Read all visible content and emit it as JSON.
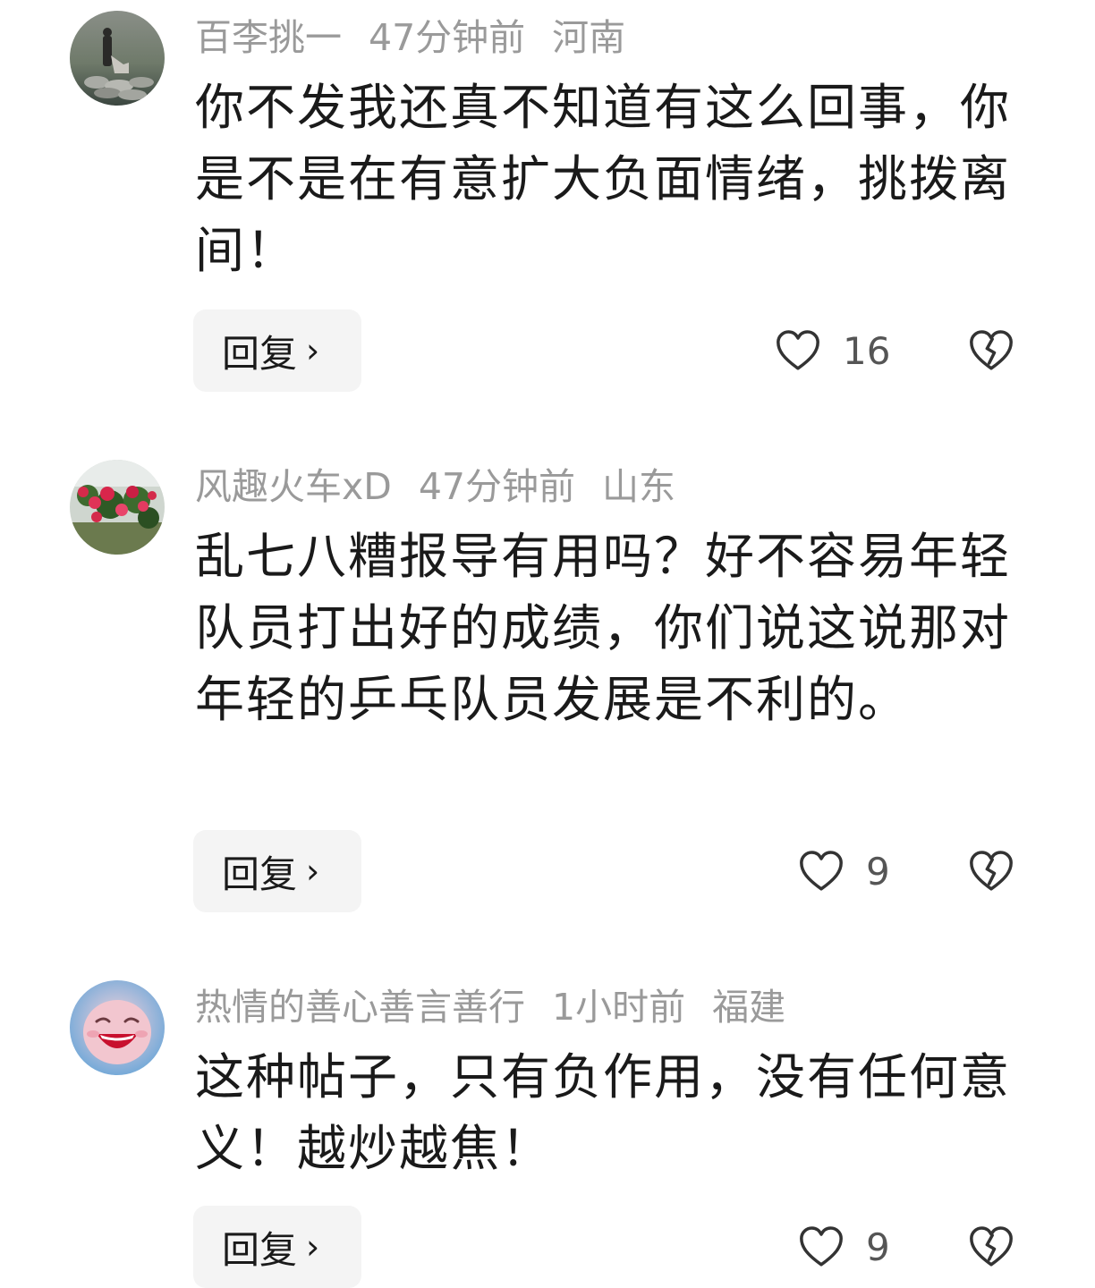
{
  "comments": [
    {
      "username": "百李挑一",
      "time": "47分钟前",
      "location": "河南",
      "text": "你不发我还真不知道有这么回事，你是不是在有意扩大负面情绪，挑拨离间！",
      "reply_label": "回复",
      "likes": "16",
      "avatar_icon": "avatar-shepherd-photo"
    },
    {
      "username": "风趣火车xD",
      "time": "47分钟前",
      "location": "山东",
      "text": "乱七八糟报导有用吗？好不容易年轻队员打出好的成绩，你们说这说那对年轻的乒乓队员发展是不利的。",
      "reply_label": "回复",
      "likes": "9",
      "avatar_icon": "avatar-flowers-photo"
    },
    {
      "username": "热情的善心善言善行",
      "time": "1小时前",
      "location": "福建",
      "text": "这种帖子，只有负作用，没有任何意义！越炒越焦！",
      "reply_label": "回复",
      "likes": "9",
      "avatar_icon": "avatar-laughing-face"
    }
  ],
  "icons": {
    "like": "heart-outline-icon",
    "dislike": "broken-heart-icon",
    "chevron": "chevron-right-icon"
  },
  "colors": {
    "meta_gray": "#9a9a9a",
    "button_bg": "#f4f4f4",
    "text": "#1a1a1a"
  }
}
